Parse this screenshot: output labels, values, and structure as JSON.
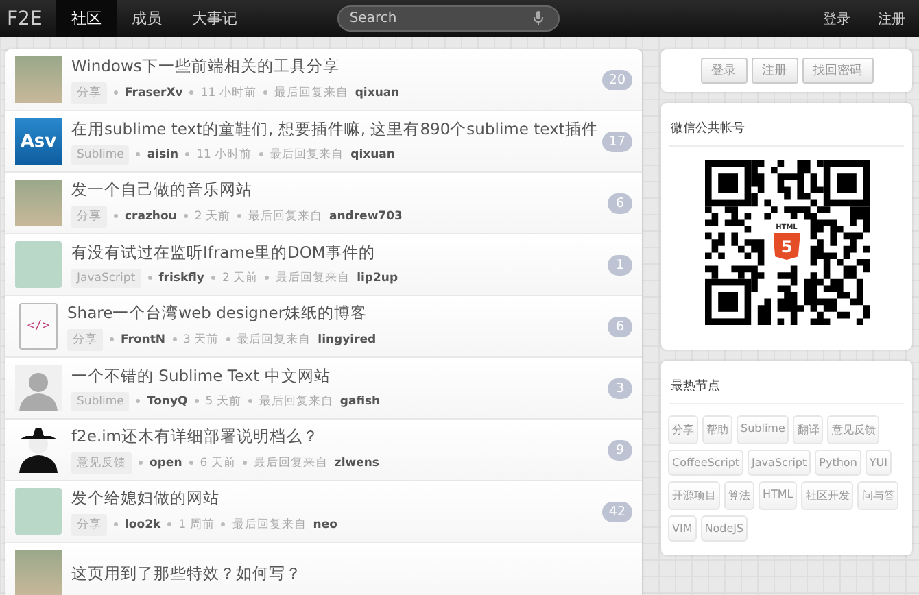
{
  "topbar": {
    "logo": "F2E",
    "nav": [
      {
        "label": "社区",
        "selected": true
      },
      {
        "label": "成员",
        "selected": false
      },
      {
        "label": "大事记",
        "selected": false
      }
    ],
    "search": {
      "placeholder": "Search"
    },
    "account": [
      "登录",
      "注册"
    ]
  },
  "topics": [
    {
      "avatar": {
        "kind": "photo"
      },
      "title": "Windows下一些前端相关的工具分享",
      "node": "分享",
      "author": "FraserXv",
      "time": "11 小时前",
      "reply_label": "最后回复来自",
      "last_reply": "qixuan",
      "count": "20"
    },
    {
      "avatar": {
        "kind": "logo",
        "text": "Asv"
      },
      "title": "在用sublime text的童鞋们, 想要插件嘛, 这里有890个sublime text插件",
      "node": "Sublime",
      "author": "aisin",
      "time": "11 小时前",
      "reply_label": "最后回复来自",
      "last_reply": "qixuan",
      "count": "17"
    },
    {
      "avatar": {
        "kind": "photo"
      },
      "title": "发一个自己做的音乐网站",
      "node": "分享",
      "author": "crazhou",
      "time": "2 天前",
      "reply_label": "最后回复来自",
      "last_reply": "andrew703",
      "count": "6"
    },
    {
      "avatar": {
        "kind": "cartoon"
      },
      "title": "有没有试过在监听Iframe里的DOM事件的",
      "node": "JavaScript",
      "author": "friskfly",
      "time": "2 天前",
      "reply_label": "最后回复来自",
      "last_reply": "lip2up",
      "count": "1"
    },
    {
      "avatar": {
        "kind": "code",
        "text": "</>"
      },
      "title": "Share一个台湾web designer妹纸的博客",
      "node": "分享",
      "author": "FrontN",
      "time": "3 天前",
      "reply_label": "最后回复来自",
      "last_reply": "lingyired",
      "count": "6"
    },
    {
      "avatar": {
        "kind": "silhouette"
      },
      "title": "一个不错的 Sublime Text 中文网站",
      "node": "Sublime",
      "author": "TonyQ",
      "time": "5 天前",
      "reply_label": "最后回复来自",
      "last_reply": "gafish",
      "count": "3"
    },
    {
      "avatar": {
        "kind": "masked"
      },
      "title": "f2e.im还木有详细部署说明档么？",
      "node": "意见反馈",
      "author": "open",
      "time": "6 天前",
      "reply_label": "最后回复来自",
      "last_reply": "zlwens",
      "count": "9"
    },
    {
      "avatar": {
        "kind": "cartoon"
      },
      "title": "发个给媳妇做的网站",
      "node": "分享",
      "author": "loo2k",
      "time": "1 周前",
      "reply_label": "最后回复来自",
      "last_reply": "neo",
      "count": "42"
    },
    {
      "avatar": {
        "kind": "photo"
      },
      "title": "这页用到了那些特效？如何写？"
    }
  ],
  "sidebar": {
    "auth_buttons": [
      "登录",
      "注册",
      "找回密码"
    ],
    "wechat": {
      "title": "微信公共帐号",
      "badge_label": "HTML",
      "badge_number": "5"
    },
    "hot_nodes": {
      "title": "最热节点",
      "tags": [
        "分享",
        "帮助",
        "Sublime",
        "翻译",
        "意见反馈",
        "CoffeeScript",
        "JavaScript",
        "Python",
        "YUI",
        "开源项目",
        "算法",
        "HTML",
        "社区开发",
        "问与答",
        "VIM",
        "NodeJS"
      ]
    }
  }
}
